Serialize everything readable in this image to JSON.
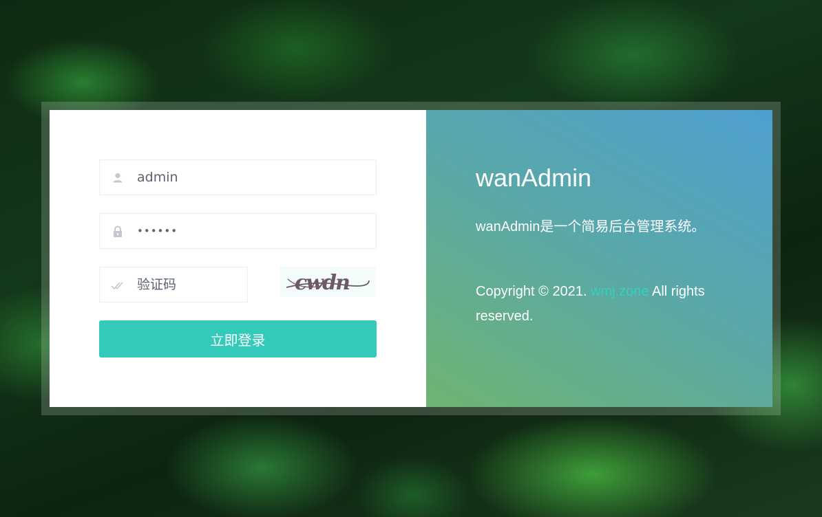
{
  "login_form": {
    "username_value": "admin",
    "password_value": "••••••",
    "captcha_placeholder": "验证码",
    "captcha_image_text": "cwdn",
    "submit_label": "立即登录"
  },
  "info_panel": {
    "title": "wanAdmin",
    "description": "wanAdmin是一个简易后台管理系统。",
    "copyright_prefix": "Copyright © 2021.",
    "copyright_link": "wmj.zone",
    "copyright_suffix": "All rights reserved."
  },
  "colors": {
    "accent": "#33c9bb",
    "link": "#35d0c0",
    "panel_gradient_start": "#6fb472",
    "panel_gradient_end": "#4e9fd0"
  },
  "icons": {
    "username": "user-icon",
    "password": "lock-icon",
    "captcha": "double-check-icon"
  }
}
